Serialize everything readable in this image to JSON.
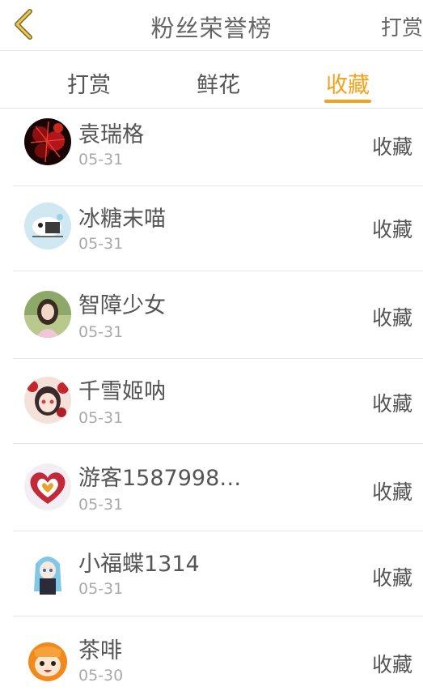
{
  "header": {
    "title": "粉丝荣誉榜",
    "action": "打赏",
    "accent": "#f5a21b"
  },
  "tabs": [
    {
      "label": "打赏",
      "active": false
    },
    {
      "label": "鲜花",
      "active": false
    },
    {
      "label": "收藏",
      "active": true
    }
  ],
  "fans": [
    {
      "name": "袁瑞格",
      "date": "05-31",
      "action": "收藏",
      "avatar": "red-flowers-avatar"
    },
    {
      "name": "冰糖末喵",
      "date": "05-31",
      "action": "收藏",
      "avatar": "cartoon-avatar"
    },
    {
      "name": "智障少女",
      "date": "05-31",
      "action": "收藏",
      "avatar": "girl-photo-avatar"
    },
    {
      "name": "千雪姬呐",
      "date": "05-31",
      "action": "收藏",
      "avatar": "anime-girl-avatar"
    },
    {
      "name": "游客1587998…",
      "date": "05-31",
      "action": "收藏",
      "avatar": "heart-avatar"
    },
    {
      "name": "小福蝶1314",
      "date": "05-31",
      "action": "收藏",
      "avatar": "anime-blue-hair-avatar"
    },
    {
      "name": "茶啡",
      "date": "05-30",
      "action": "收藏",
      "avatar": "anime-orange-avatar"
    }
  ]
}
